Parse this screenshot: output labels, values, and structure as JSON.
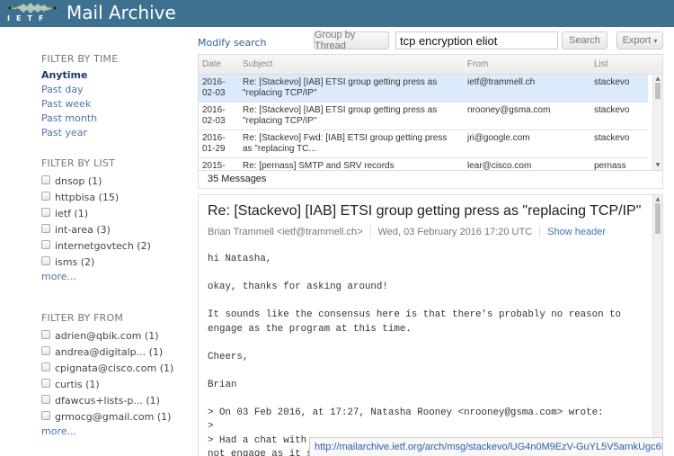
{
  "header": {
    "logo_text": "IETF",
    "app_title": "Mail Archive"
  },
  "toolbar": {
    "modify_search": "Modify search",
    "group_by_thread": "Group by Thread",
    "search_value": "tcp encryption eliot",
    "search_button": "Search",
    "export_button": "Export",
    "export_caret": "▾"
  },
  "sidebar": {
    "time": {
      "title": "FILTER BY TIME",
      "items": [
        {
          "label": "Anytime",
          "active": true
        },
        {
          "label": "Past day"
        },
        {
          "label": "Past week"
        },
        {
          "label": "Past month"
        },
        {
          "label": "Past year"
        }
      ]
    },
    "list": {
      "title": "FILTER BY LIST",
      "items": [
        {
          "label": "dnsop (1)"
        },
        {
          "label": "httpbisa (15)"
        },
        {
          "label": "ietf (1)"
        },
        {
          "label": "int-area (3)"
        },
        {
          "label": "internetgovtech (2)"
        },
        {
          "label": "isms (2)"
        }
      ],
      "more": "more..."
    },
    "from": {
      "title": "FILTER BY FROM",
      "items": [
        {
          "label": "adrien@qbik.com (1)"
        },
        {
          "label": "andrea@digitalp... (1)"
        },
        {
          "label": "cpignata@cisco.com (1)"
        },
        {
          "label": "curtis (1)"
        },
        {
          "label": "dfawcus+lists-p... (1)"
        },
        {
          "label": "grmocg@gmail.com (1)"
        }
      ],
      "more": "more..."
    }
  },
  "message_list": {
    "columns": {
      "date": "Date",
      "subject": "Subject",
      "from": "From",
      "list": "List"
    },
    "rows": [
      {
        "date": "2016-\n02-03",
        "subject": "Re: [Stackevo] [IAB] ETSI group getting press as \"replacing TCP/IP\"",
        "from": "ietf@trammell.ch",
        "list": "stackevo",
        "selected": true
      },
      {
        "date": "2016-\n02-03",
        "subject": "Re: [Stackevo] [IAB] ETSI group getting press as \"replacing TCP/IP\"",
        "from": "nrooney@gsma.com",
        "list": "stackevo"
      },
      {
        "date": "2016-\n01-29",
        "subject": "Re: [Stackevo] Fwd: [IAB] ETSI group getting press as \"replacing TC...",
        "from": "jri@google.com",
        "list": "stackevo"
      },
      {
        "date": "2015-",
        "subject": "Re: [pernass] SMTP and SRV records",
        "from": "lear@cisco.com",
        "list": "pernass"
      }
    ],
    "count": "35 Messages"
  },
  "message": {
    "subject": "Re: [Stackevo] [IAB] ETSI group getting press as \"replacing TCP/IP\"",
    "from": "Brian Trammell <ietf@trammell.ch>",
    "date": "Wed, 03 February 2016 17:20 UTC",
    "show_header": "Show header",
    "body": "hi Natasha,\n\nokay, thanks for asking around!\n\nIt sounds like the consensus here is that there's probably no reason to\nengage as the program at this time.\n\nCheers,\n\nBrian\n\n> On 03 Feb 2016, at 17:27, Natasha Rooney <nrooney@gsma.com> wrote:\n>\n> Had a chat with\nnot engage as it seems"
  },
  "status_url": "http://mailarchive.ietf.org/arch/msg/stackevo/UG4n0M9EzV-GuYL5V5arnkUgc6M"
}
